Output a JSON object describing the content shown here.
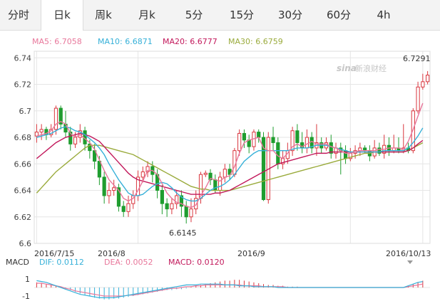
{
  "tabs": [
    {
      "label": "分时",
      "active": false
    },
    {
      "label": "日k",
      "active": true
    },
    {
      "label": "周k",
      "active": false
    },
    {
      "label": "月k",
      "active": false
    },
    {
      "label": "5分",
      "active": false
    },
    {
      "label": "15分",
      "active": false
    },
    {
      "label": "30分",
      "active": false
    },
    {
      "label": "60分",
      "active": false
    },
    {
      "label": "4h",
      "active": false
    }
  ],
  "ma_legend": {
    "ma5": "MA5: 6.7058",
    "ma10": "MA10: 6.6871",
    "ma20": "MA20: 6.6777",
    "ma30": "MA30: 6.6759"
  },
  "macd_legend": {
    "title": "MACD",
    "dif": "DIF: 0.0112",
    "dea": "DEA: 0.0052",
    "macd": "MACD: 0.0120"
  },
  "watermark": "新浪财经",
  "logo_text": "sina",
  "colors": {
    "up": "#d9363e",
    "down": "#1f9d2f",
    "ma5": "#e8779b",
    "ma10": "#35b0d8",
    "ma20": "#c2185b",
    "ma30": "#9aab3c",
    "grid": "#e6e6e6",
    "macd_dif": "#35b0d8",
    "macd_dea": "#e8779b"
  },
  "chart_data": {
    "type": "candlestick",
    "yticks": [
      "6.74",
      "6.72",
      "6.7",
      "6.68",
      "6.66",
      "6.64",
      "6.62",
      "6.6"
    ],
    "ylim": [
      6.6,
      6.745
    ],
    "date_labels": [
      "2016/7/15",
      "2016/8",
      "2016/9",
      "2016/10/13"
    ],
    "annotations": {
      "high": "6.7291",
      "low": "6.6145"
    },
    "macd_yticks": [
      "1",
      "-1"
    ],
    "candles": [
      [
        6.681,
        6.684,
        6.69,
        6.676
      ],
      [
        6.684,
        6.686,
        6.69,
        6.678
      ],
      [
        6.686,
        6.682,
        6.688,
        6.678
      ],
      [
        6.682,
        6.686,
        6.69,
        6.68
      ],
      [
        6.686,
        6.702,
        6.704,
        6.682
      ],
      [
        6.702,
        6.69,
        6.704,
        6.686
      ],
      [
        6.69,
        6.684,
        6.7,
        6.68
      ],
      [
        6.684,
        6.675,
        6.688,
        6.67
      ],
      [
        6.675,
        6.68,
        6.684,
        6.672
      ],
      [
        6.68,
        6.685,
        6.69,
        6.676
      ],
      [
        6.685,
        6.675,
        6.688,
        6.67
      ],
      [
        6.675,
        6.67,
        6.678,
        6.664
      ],
      [
        6.67,
        6.662,
        6.675,
        6.656
      ],
      [
        6.662,
        6.65,
        6.666,
        6.644
      ],
      [
        6.65,
        6.636,
        6.654,
        6.63
      ],
      [
        6.636,
        6.64,
        6.646,
        6.63
      ],
      [
        6.64,
        6.642,
        6.648,
        6.636
      ],
      [
        6.642,
        6.628,
        6.645,
        6.624
      ],
      [
        6.628,
        6.624,
        6.632,
        6.62
      ],
      [
        6.624,
        6.63,
        6.636,
        6.62
      ],
      [
        6.63,
        6.636,
        6.64,
        6.626
      ],
      [
        6.636,
        6.65,
        6.655,
        6.632
      ],
      [
        6.65,
        6.654,
        6.658,
        6.646
      ],
      [
        6.654,
        6.658,
        6.662,
        6.65
      ],
      [
        6.658,
        6.652,
        6.662,
        6.646
      ],
      [
        6.652,
        6.64,
        6.656,
        6.634
      ],
      [
        6.64,
        6.63,
        6.644,
        6.622
      ],
      [
        6.63,
        6.626,
        6.634,
        6.62
      ],
      [
        6.626,
        6.63,
        6.634,
        6.622
      ],
      [
        6.63,
        6.636,
        6.64,
        6.626
      ],
      [
        6.636,
        6.628,
        6.64,
        6.62
      ],
      [
        6.628,
        6.62,
        6.632,
        6.615
      ],
      [
        6.62,
        6.626,
        6.634,
        6.616
      ],
      [
        6.626,
        6.634,
        6.64,
        6.622
      ],
      [
        6.634,
        6.652,
        6.654,
        6.63
      ],
      [
        6.652,
        6.653,
        6.655,
        6.65
      ],
      [
        6.653,
        6.648,
        6.656,
        6.644
      ],
      [
        6.648,
        6.64,
        6.652,
        6.638
      ],
      [
        6.64,
        6.65,
        6.654,
        6.636
      ],
      [
        6.65,
        6.656,
        6.66,
        6.646
      ],
      [
        6.656,
        6.652,
        6.66,
        6.648
      ],
      [
        6.652,
        6.67,
        6.672,
        6.65
      ],
      [
        6.67,
        6.683,
        6.686,
        6.666
      ],
      [
        6.683,
        6.678,
        6.686,
        6.672
      ],
      [
        6.678,
        6.673,
        6.682,
        6.668
      ],
      [
        6.673,
        6.684,
        6.686,
        6.67
      ],
      [
        6.684,
        6.68,
        6.686,
        6.676
      ],
      [
        6.68,
        6.633,
        6.684,
        6.632
      ],
      [
        6.633,
        6.68,
        6.684,
        6.63
      ],
      [
        6.68,
        6.676,
        6.688,
        6.67
      ],
      [
        6.676,
        6.66,
        6.68,
        6.656
      ],
      [
        6.66,
        6.664,
        6.67,
        6.656
      ],
      [
        6.664,
        6.67,
        6.676,
        6.66
      ],
      [
        6.67,
        6.685,
        6.688,
        6.666
      ],
      [
        6.685,
        6.676,
        6.69,
        6.67
      ],
      [
        6.676,
        6.672,
        6.684,
        6.668
      ],
      [
        6.672,
        6.68,
        6.686,
        6.668
      ],
      [
        6.68,
        6.672,
        6.684,
        6.668
      ],
      [
        6.672,
        6.676,
        6.69,
        6.666
      ],
      [
        6.676,
        6.672,
        6.68,
        6.668
      ],
      [
        6.672,
        6.676,
        6.68,
        6.67
      ],
      [
        6.676,
        6.668,
        6.682,
        6.664
      ],
      [
        6.668,
        6.672,
        6.676,
        6.664
      ],
      [
        6.672,
        6.67,
        6.676,
        6.652
      ],
      [
        6.67,
        6.664,
        6.674,
        6.66
      ],
      [
        6.664,
        6.668,
        6.672,
        6.662
      ],
      [
        6.668,
        6.67,
        6.674,
        6.664
      ],
      [
        6.67,
        6.672,
        6.676,
        6.666
      ],
      [
        6.672,
        6.67,
        6.674,
        6.668
      ],
      [
        6.67,
        6.666,
        6.674,
        6.662
      ],
      [
        6.666,
        6.672,
        6.678,
        6.664
      ],
      [
        6.672,
        6.668,
        6.676,
        6.666
      ],
      [
        6.668,
        6.674,
        6.682,
        6.664
      ],
      [
        6.674,
        6.67,
        6.68,
        6.666
      ],
      [
        6.67,
        6.672,
        6.682,
        6.668
      ],
      [
        6.672,
        6.67,
        6.68,
        6.668
      ],
      [
        6.67,
        6.672,
        6.69,
        6.668
      ],
      [
        6.672,
        6.67,
        6.676,
        6.668
      ],
      [
        6.67,
        6.7,
        6.702,
        6.668
      ],
      [
        6.7,
        6.718,
        6.722,
        6.698
      ],
      [
        6.718,
        6.722,
        6.728,
        6.716
      ],
      [
        6.722,
        6.727,
        6.73,
        6.72
      ]
    ],
    "ma5": [
      6.681,
      6.682,
      6.683,
      6.685,
      6.69,
      6.692,
      6.69,
      6.683,
      6.68,
      6.682,
      6.679,
      6.676,
      6.671,
      6.663,
      6.655,
      6.648,
      6.644,
      6.64,
      6.634,
      6.632,
      6.634,
      6.64,
      6.647,
      6.655,
      6.655,
      6.652,
      6.645,
      6.638,
      6.634,
      6.631,
      6.63,
      6.628,
      6.627,
      6.629,
      6.636,
      6.642,
      6.649,
      6.648,
      6.647,
      6.65,
      6.651,
      6.658,
      6.668,
      6.676,
      6.678,
      6.679,
      6.68,
      6.672,
      6.67,
      6.67,
      6.666,
      6.664,
      6.668,
      6.673,
      6.675,
      6.673,
      6.675,
      6.677,
      6.675,
      6.675,
      6.675,
      6.673,
      6.672,
      6.67,
      6.668,
      6.668,
      6.669,
      6.67,
      6.67,
      6.67,
      6.67,
      6.671,
      6.671,
      6.672,
      6.672,
      6.672,
      6.671,
      6.677,
      6.686,
      6.696,
      6.7058
    ],
    "ma10": [
      6.68,
      6.681,
      6.682,
      6.683,
      6.685,
      6.687,
      6.688,
      6.687,
      6.685,
      6.684,
      6.682,
      6.679,
      6.676,
      6.672,
      6.667,
      6.66,
      6.654,
      6.648,
      6.643,
      6.638,
      6.636,
      6.636,
      6.637,
      6.64,
      6.643,
      6.645,
      6.646,
      6.645,
      6.642,
      6.638,
      6.635,
      6.633,
      6.632,
      6.632,
      6.634,
      6.637,
      6.64,
      6.642,
      6.643,
      6.645,
      6.648,
      6.652,
      6.657,
      6.662,
      6.665,
      6.668,
      6.67,
      6.67,
      6.67,
      6.67,
      6.67,
      6.67,
      6.67,
      6.671,
      6.672,
      6.672,
      6.672,
      6.673,
      6.674,
      6.674,
      6.674,
      6.673,
      6.672,
      6.671,
      6.67,
      6.669,
      6.669,
      6.669,
      6.669,
      6.669,
      6.669,
      6.669,
      6.67,
      6.67,
      6.67,
      6.67,
      6.67,
      6.672,
      6.676,
      6.681,
      6.6871
    ],
    "ma20": [
      6.664,
      6.667,
      6.67,
      6.673,
      6.676,
      6.678,
      6.68,
      6.681,
      6.682,
      6.683,
      6.682,
      6.681,
      6.679,
      6.677,
      6.673,
      6.669,
      6.665,
      6.661,
      6.657,
      6.653,
      6.65,
      6.648,
      6.647,
      6.646,
      6.645,
      6.644,
      6.643,
      6.642,
      6.641,
      6.64,
      6.639,
      6.638,
      6.637,
      6.637,
      6.637,
      6.637,
      6.637,
      6.638,
      6.638,
      6.639,
      6.64,
      6.642,
      6.644,
      6.646,
      6.648,
      6.65,
      6.652,
      6.654,
      6.656,
      6.658,
      6.66,
      6.661,
      6.662,
      6.663,
      6.664,
      6.665,
      6.666,
      6.667,
      6.668,
      6.668,
      6.668,
      6.669,
      6.669,
      6.669,
      6.669,
      6.669,
      6.669,
      6.669,
      6.669,
      6.669,
      6.669,
      6.669,
      6.669,
      6.669,
      6.669,
      6.669,
      6.669,
      6.67,
      6.672,
      6.675,
      6.6777
    ],
    "ma30": [
      6.638,
      6.642,
      6.646,
      6.65,
      6.654,
      6.657,
      6.66,
      6.663,
      6.666,
      6.669,
      6.672,
      6.674,
      6.674,
      6.674,
      6.673,
      6.672,
      6.671,
      6.67,
      6.669,
      6.668,
      6.667,
      6.665,
      6.663,
      6.661,
      6.659,
      6.657,
      6.655,
      6.653,
      6.651,
      6.649,
      6.647,
      6.645,
      6.643,
      6.642,
      6.641,
      6.641,
      6.64,
      6.64,
      6.64,
      6.64,
      6.64,
      6.641,
      6.642,
      6.643,
      6.644,
      6.645,
      6.646,
      6.647,
      6.648,
      6.649,
      6.65,
      6.651,
      6.652,
      6.653,
      6.654,
      6.655,
      6.656,
      6.657,
      6.658,
      6.659,
      6.66,
      6.661,
      6.662,
      6.663,
      6.664,
      6.665,
      6.666,
      6.667,
      6.668,
      6.668,
      6.669,
      6.669,
      6.669,
      6.669,
      6.669,
      6.669,
      6.669,
      6.67,
      6.672,
      6.674,
      6.6759
    ],
    "macd_hist": [
      0.6,
      0.5,
      0.4,
      0.3,
      0.2,
      0.1,
      -0.1,
      -0.3,
      -0.5,
      -0.7,
      -0.9,
      -1.0,
      -1.2,
      -1.3,
      -1.4,
      -1.4,
      -1.3,
      -1.3,
      -1.2,
      -1.1,
      -1.0,
      -0.9,
      -0.8,
      -0.7,
      -0.6,
      -0.5,
      -0.4,
      -0.3,
      -0.3,
      -0.2,
      -0.2,
      -0.1,
      0.1,
      0.2,
      0.3,
      0.4,
      0.5,
      0.6,
      0.7,
      0.8,
      0.8,
      0.9,
      0.9,
      0.8,
      0.7,
      0.6,
      0.5,
      0.4,
      0.3,
      0.3,
      0.2,
      0.2,
      0.1,
      0.1,
      0.1,
      0.0,
      0.0,
      0.0,
      0.0,
      0.0,
      0.0,
      0.0,
      0.0,
      0.0,
      0.0,
      0.0,
      0.0,
      0.0,
      0.0,
      0.0,
      0.0,
      0.0,
      0.0,
      0.0,
      0.0,
      0.0,
      0.0,
      0.2,
      0.4,
      0.6,
      0.8
    ],
    "macd_dif": [
      0.8,
      0.7,
      0.6,
      0.4,
      0.2,
      0.0,
      -0.2,
      -0.4,
      -0.6,
      -0.8,
      -0.9,
      -1.0,
      -1.1,
      -1.2,
      -1.2,
      -1.2,
      -1.2,
      -1.1,
      -1.0,
      -0.9,
      -0.8,
      -0.7,
      -0.6,
      -0.5,
      -0.4,
      -0.3,
      -0.2,
      -0.1,
      0.0,
      0.1,
      0.2,
      0.3,
      0.3,
      0.3,
      0.4,
      0.4,
      0.4,
      0.4,
      0.4,
      0.3,
      0.3,
      0.3,
      0.2,
      0.2,
      0.2,
      0.1,
      0.1,
      0.1,
      0.1,
      0.1,
      0.0,
      0.0,
      0.0,
      0.0,
      0.0,
      0.0,
      0.0,
      0.0,
      0.0,
      0.0,
      0.0,
      0.0,
      0.0,
      0.0,
      0.0,
      0.0,
      0.0,
      0.0,
      0.0,
      0.0,
      0.0,
      0.0,
      0.0,
      0.0,
      0.0,
      0.0,
      0.0,
      0.2,
      0.4,
      0.6,
      0.7
    ],
    "macd_dea": [
      0.5,
      0.5,
      0.4,
      0.3,
      0.2,
      0.1,
      -0.1,
      -0.2,
      -0.4,
      -0.5,
      -0.6,
      -0.7,
      -0.8,
      -0.9,
      -1.0,
      -1.0,
      -1.0,
      -1.0,
      -1.0,
      -0.9,
      -0.9,
      -0.8,
      -0.7,
      -0.6,
      -0.5,
      -0.4,
      -0.3,
      -0.2,
      -0.1,
      -0.1,
      0.0,
      0.1,
      0.1,
      0.2,
      0.2,
      0.3,
      0.3,
      0.3,
      0.3,
      0.3,
      0.3,
      0.3,
      0.3,
      0.2,
      0.2,
      0.2,
      0.2,
      0.1,
      0.1,
      0.1,
      0.1,
      0.1,
      0.0,
      0.0,
      0.0,
      0.0,
      0.0,
      0.0,
      0.0,
      0.0,
      0.0,
      0.0,
      0.0,
      0.0,
      0.0,
      0.0,
      0.0,
      0.0,
      0.0,
      0.0,
      0.0,
      0.0,
      0.0,
      0.0,
      0.0,
      0.0,
      0.0,
      0.1,
      0.2,
      0.3,
      0.4
    ]
  }
}
